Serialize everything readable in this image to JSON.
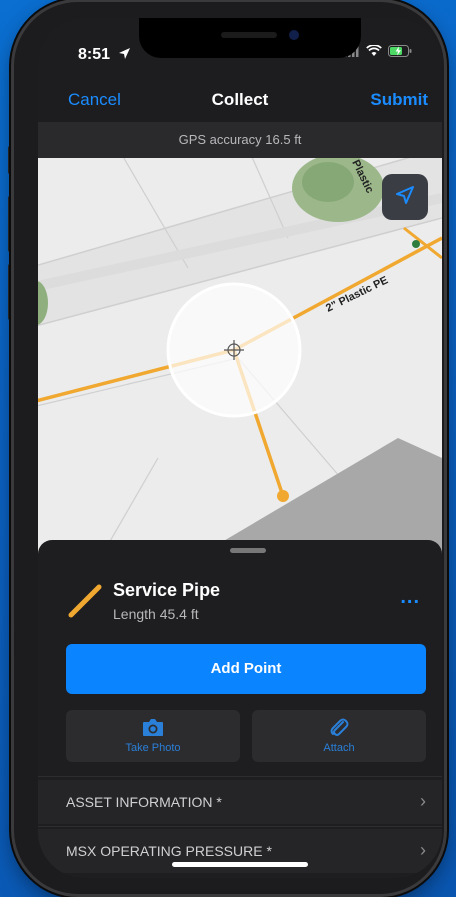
{
  "status_bar": {
    "time": "8:51"
  },
  "nav": {
    "cancel_label": "Cancel",
    "title": "Collect",
    "submit_label": "Submit"
  },
  "gps": {
    "accuracy_text": "GPS accuracy 16.5 ft"
  },
  "map": {
    "pipe_label": "2\" Plastic PE",
    "partial_label": "Plastic",
    "pipe_color": "#f0a830"
  },
  "feature": {
    "name": "Service Pipe",
    "length_text": "Length 45.4 ft",
    "more_label": "..."
  },
  "actions": {
    "add_point_label": "Add Point",
    "take_photo_label": "Take Photo",
    "attach_label": "Attach"
  },
  "sections": [
    {
      "label": "ASSET INFORMATION *"
    },
    {
      "label": "MSX OPERATING PRESSURE *"
    }
  ],
  "colors": {
    "accent": "#0a84ff",
    "background": "#0b62c4",
    "sheet": "#1e1e20"
  }
}
